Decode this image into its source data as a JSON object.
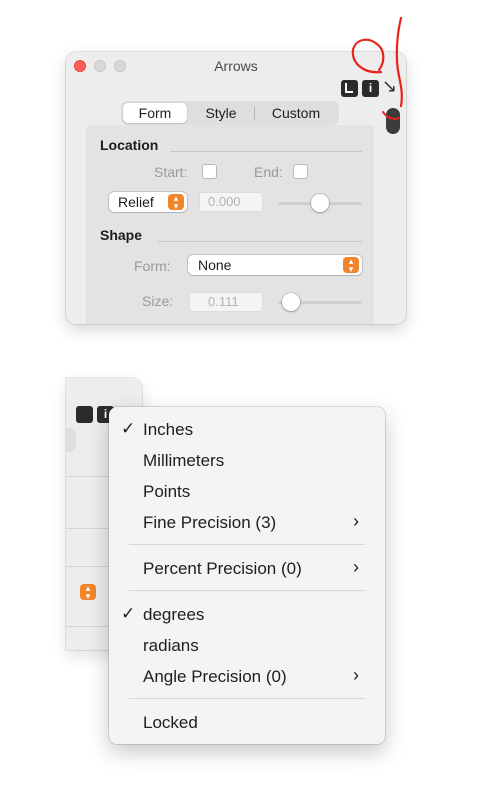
{
  "window": {
    "title": "Arrows",
    "tabs": [
      "Form",
      "Style",
      "Custom"
    ],
    "location": {
      "heading": "Location",
      "start_label": "Start:",
      "end_label": "End:",
      "relief_popup": "Relief",
      "value_field": "0.000"
    },
    "shape": {
      "heading": "Shape",
      "form_label": "Form:",
      "form_popup": "None",
      "size_label": "Size:",
      "size_field": "0.111"
    }
  },
  "menu": {
    "group1": [
      {
        "label": "Inches",
        "checked": true
      },
      {
        "label": "Millimeters",
        "checked": false
      },
      {
        "label": "Points",
        "checked": false
      },
      {
        "label": "Fine Precision (3)",
        "submenu": true
      }
    ],
    "group2": [
      {
        "label": "Percent Precision (0)",
        "submenu": true
      }
    ],
    "group3": [
      {
        "label": "degrees",
        "checked": true
      },
      {
        "label": "radians",
        "checked": false
      },
      {
        "label": "Angle Precision (0)",
        "submenu": true
      }
    ],
    "group4": [
      {
        "label": "Locked",
        "checked": false
      }
    ],
    "check_glyph": "✓",
    "submenu_glyph": "›"
  },
  "colors": {
    "close_button": "#ff5f57",
    "stepper_accent": "#f0852b",
    "annotation_scribble": "#e8251b"
  }
}
